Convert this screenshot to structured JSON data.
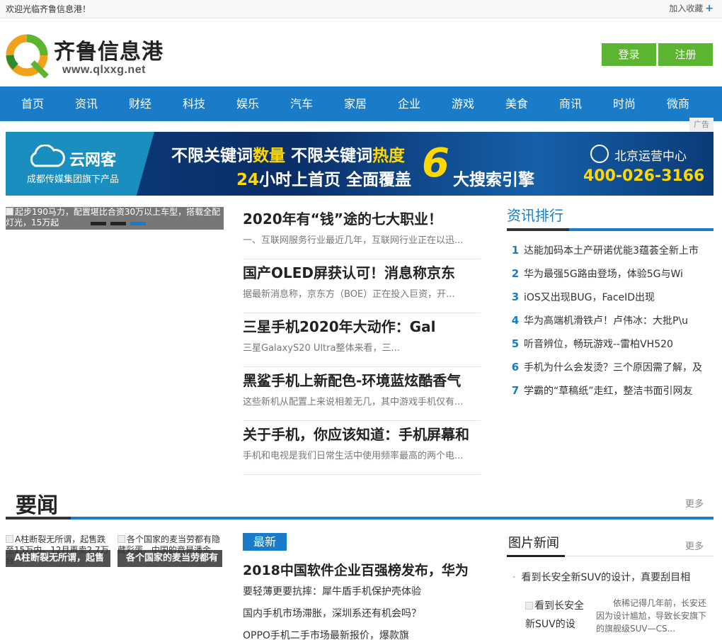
{
  "topbar": {
    "welcome": "欢迎光临齐鲁信息港！",
    "favorite": "加入收藏"
  },
  "logo": {
    "brand": "齐鲁信息港",
    "url": "www.qlxxg.net",
    "mark": "Q"
  },
  "auth": {
    "login": "登录",
    "register": "注册"
  },
  "nav": [
    "首页",
    "资讯",
    "财经",
    "科技",
    "娱乐",
    "汽车",
    "家居",
    "企业",
    "游戏",
    "美食",
    "商讯",
    "时尚",
    "微商"
  ],
  "ad": {
    "tag": "广告",
    "brand": "云网客",
    "sub": "成都传媒集团旗下产品",
    "line1_a": "不限关键词",
    "line1_b": "数量",
    "line1_c": " 不限关键词",
    "line1_d": "热度",
    "line2_a": "24",
    "line2_b": "小时上首页  全面覆盖",
    "six": "6",
    "line3": "大搜索引擎",
    "center": "北京运营中心",
    "tel": "400-026-3166"
  },
  "slider": {
    "caption": "起步190马力，配置堪比合资30万以上车型，搭载全配灯光，15万起"
  },
  "headlines": [
    {
      "title": "2020年有“钱”途的七大职业！",
      "desc": "一、互联网服务行业最近几年，互联网行业正在以迅..."
    },
    {
      "title": "国产OLED屏获认可！消息称京东",
      "desc": "据最新消息称，京东方（BOE）正在投入巨资，开..."
    },
    {
      "title": "三星手机2020年大动作：Gal",
      "desc": "三星GalaxyS20 Ultra整体来看，三..."
    },
    {
      "title": "黑鲨手机上新配色-环境蓝炫酷香气",
      "desc": "这些新机从配置上来说相差无几，其中游戏手机仅有..."
    },
    {
      "title": "关于手机，你应该知道：手机屏幕和",
      "desc": "手机和电视是我们日常生活中使用频率最高的两个电..."
    }
  ],
  "ranking": {
    "title": "资讯排行",
    "items": [
      {
        "n": "1",
        "text": "达能加码本土产研诺优能3蕴荟全新上市"
      },
      {
        "n": "2",
        "text": "华为最强5G路由登场，体验5G与Wi"
      },
      {
        "n": "3",
        "text": "iOS又出现BUG，FaceID出现"
      },
      {
        "n": "4",
        "text": "华为高端机滑铁卢！卢伟冰：大批P\\u"
      },
      {
        "n": "5",
        "text": "听音辨位，畅玩游戏--雷柏VH520"
      },
      {
        "n": "6",
        "text": "手机为什么会发烫？三个原因需了解，及"
      },
      {
        "n": "7",
        "text": "学霸的“草稿纸”走红，整洁书面引网友"
      }
    ]
  },
  "yaowen": {
    "title": "要闻",
    "more": "更多",
    "thumbs": [
      {
        "alt": "A柱断裂无所谓，起售跌至15万内，12月再卖2.7万台",
        "cap": "A柱断裂无所谓，起售"
      },
      {
        "alt": "各个国家的麦当劳都有隐藏彩蛋，中国的竟是潘金",
        "cap": "各个国家的麦当劳都有"
      }
    ],
    "tag": "最新",
    "main": "2018中国软件企业百强榜发布，华为",
    "list": [
      "要轻薄更要抗摔：犀牛盾手机保护壳体验",
      "国内手机市场滞胀，深圳系还有机会吗？",
      "OPPO手机二手市场最新报价，爆款旗"
    ]
  },
  "pics": {
    "title": "图片新闻",
    "more": "更多",
    "item": "看到长安全新SUV的设计，真要刮目相",
    "img_alt": "看到长安全新SUV的设",
    "desc": "依稀记得几年前，长安还因为设计尴尬，导致长安旗下的旗舰级SUV—CS..."
  },
  "colors": {
    "brand_blue": "#1a7cc9",
    "green": "#5cb531"
  }
}
